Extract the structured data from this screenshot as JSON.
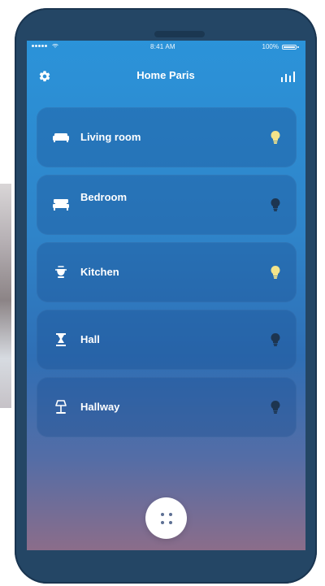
{
  "status_bar": {
    "time": "8:41 AM",
    "battery": "100%"
  },
  "header": {
    "title": "Home Paris"
  },
  "rooms": [
    {
      "name": "Living room",
      "icon": "sofa-icon",
      "light_status": "on"
    },
    {
      "name": "Bedroom",
      "icon": "bed-icon",
      "light_status": "off"
    },
    {
      "name": "Kitchen",
      "icon": "pot-icon",
      "light_status": "on"
    },
    {
      "name": "Hall",
      "icon": "hourglass-icon",
      "light_status": "off"
    },
    {
      "name": "Hallway",
      "icon": "lamp-icon",
      "light_status": "off"
    }
  ],
  "fab": {
    "icon": "grid-dots-icon"
  },
  "colors": {
    "screen_top": "#2b93d9",
    "screen_bottom": "#8b6d8a",
    "card_bg": "#1a4e8f",
    "light_on": "#f2e38a",
    "light_off": "#1d3550"
  }
}
